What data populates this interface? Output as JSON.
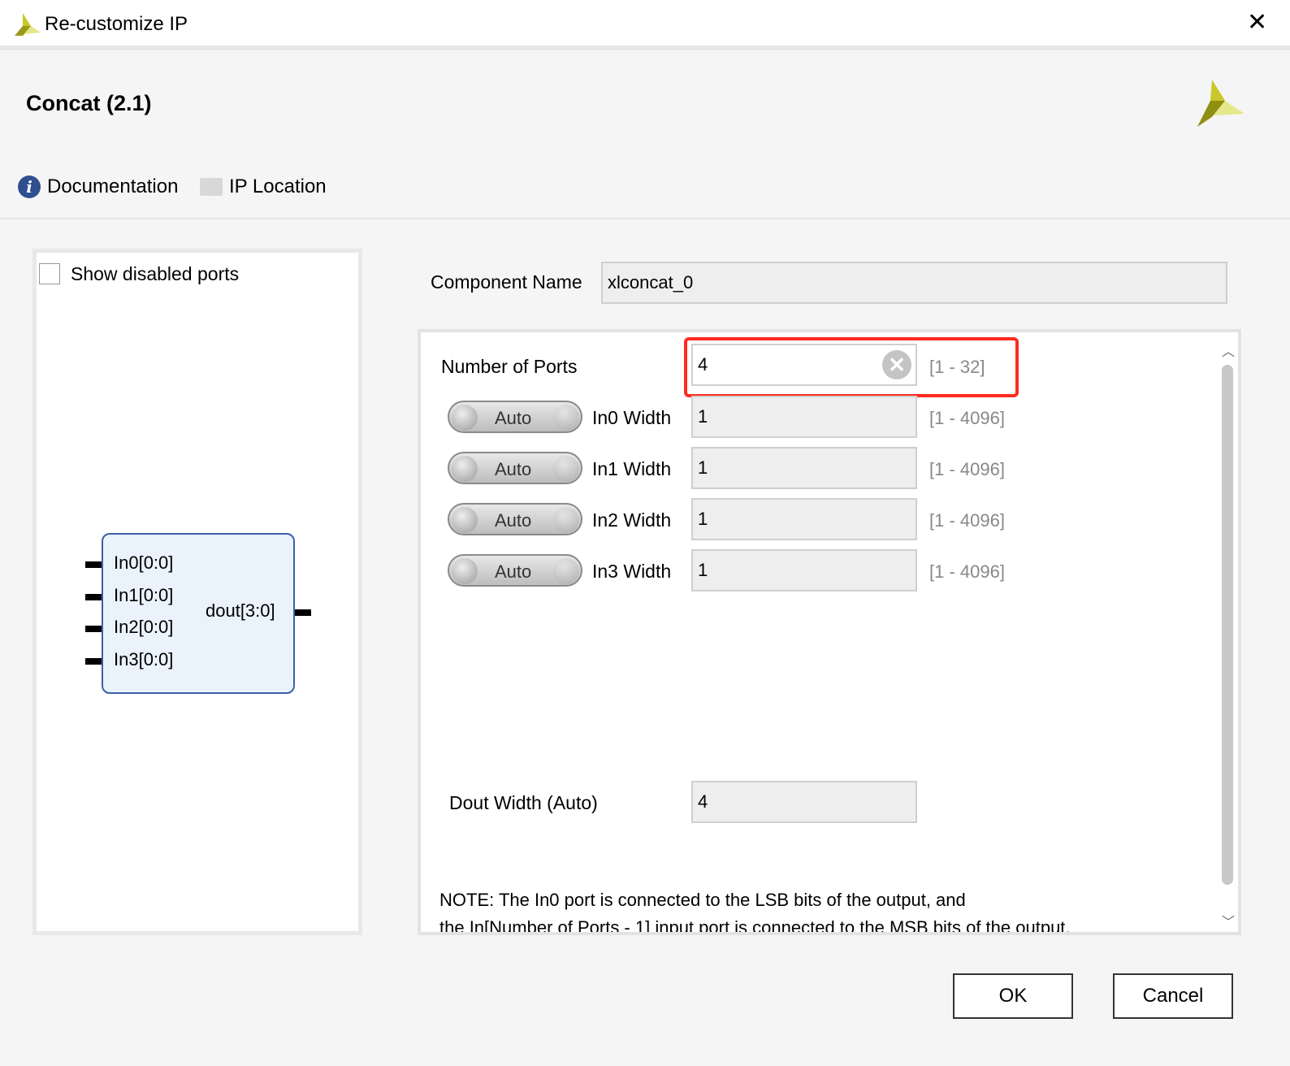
{
  "window": {
    "title": "Re-customize IP",
    "close_icon": "close-icon"
  },
  "header": {
    "title": "Concat (2.1)",
    "documentation": "Documentation",
    "ip_location": "IP Location"
  },
  "left": {
    "show_disabled_label": "Show disabled ports",
    "show_disabled_checked": false,
    "inputs": [
      "In0[0:0]",
      "In1[0:0]",
      "In2[0:0]",
      "In3[0:0]"
    ],
    "output": "dout[3:0]"
  },
  "form": {
    "component_name_label": "Component Name",
    "component_name": "xlconcat_0",
    "num_ports_label": "Number of Ports",
    "num_ports": "4",
    "num_ports_range": "[1 - 32]",
    "widths": [
      {
        "toggle": "Auto",
        "label": "In0 Width",
        "value": "1",
        "range": "[1 - 4096]"
      },
      {
        "toggle": "Auto",
        "label": "In1 Width",
        "value": "1",
        "range": "[1 - 4096]"
      },
      {
        "toggle": "Auto",
        "label": "In2 Width",
        "value": "1",
        "range": "[1 - 4096]"
      },
      {
        "toggle": "Auto",
        "label": "In3 Width",
        "value": "1",
        "range": "[1 - 4096]"
      }
    ],
    "dout_label": "Dout Width (Auto)",
    "dout_value": "4",
    "note1": "NOTE: The In0 port is connected to the LSB bits of the output, and",
    "note2": "the In[Number of Ports - 1] input port is connected to the MSB bits of the output."
  },
  "buttons": {
    "ok": "OK",
    "cancel": "Cancel"
  },
  "colors": {
    "highlight": "#ff2a1f",
    "accent": "#3d5fa8"
  }
}
